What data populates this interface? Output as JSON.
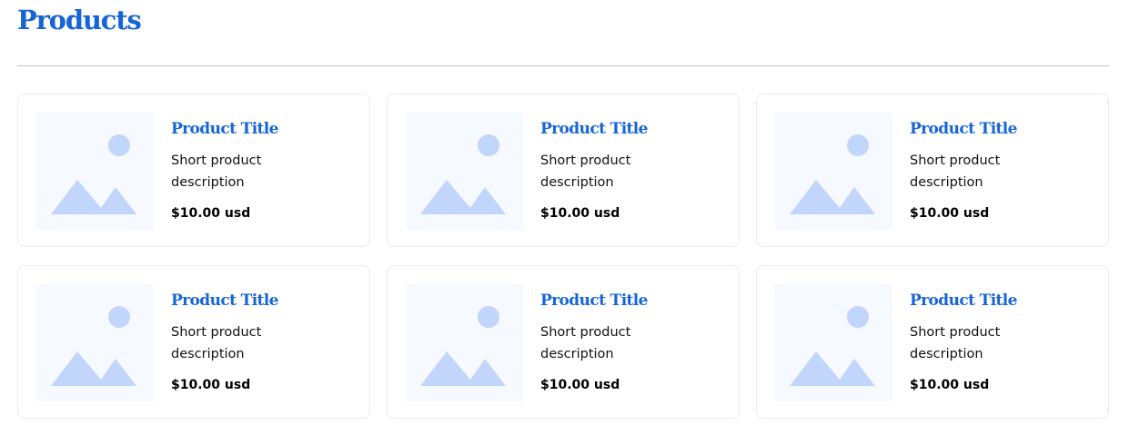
{
  "header": {
    "title": "Products"
  },
  "colors": {
    "accent": "#1565d8",
    "placeholder_bg": "#f6f9ff",
    "placeholder_shape": "#c2d5fb",
    "divider": "#c4c4c4",
    "card_border": "#ebebeb"
  },
  "products": [
    {
      "title": "Product Title",
      "description": "Short product description",
      "price": "$10.00 usd",
      "image_icon": "image-placeholder-icon"
    },
    {
      "title": "Product Title",
      "description": "Short product description",
      "price": "$10.00 usd",
      "image_icon": "image-placeholder-icon"
    },
    {
      "title": "Product Title",
      "description": "Short product description",
      "price": "$10.00 usd",
      "image_icon": "image-placeholder-icon"
    },
    {
      "title": "Product Title",
      "description": "Short product description",
      "price": "$10.00 usd",
      "image_icon": "image-placeholder-icon"
    },
    {
      "title": "Product Title",
      "description": "Short product description",
      "price": "$10.00 usd",
      "image_icon": "image-placeholder-icon"
    },
    {
      "title": "Product Title",
      "description": "Short product description",
      "price": "$10.00 usd",
      "image_icon": "image-placeholder-icon"
    }
  ]
}
